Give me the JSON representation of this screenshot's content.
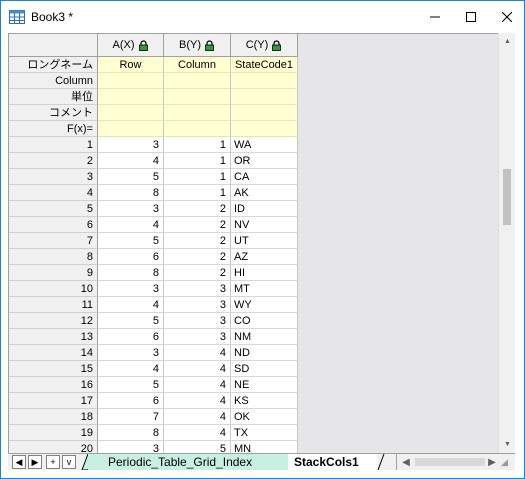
{
  "window": {
    "title": "Book3 *",
    "min_label": "🗕",
    "max_label": "☐",
    "close_label": "✕"
  },
  "columns": [
    {
      "header": "A(X)",
      "longname": "Row",
      "align": "num"
    },
    {
      "header": "B(Y)",
      "longname": "Column",
      "align": "num"
    },
    {
      "header": "C(Y)",
      "longname": "StateCode1",
      "align": "txt"
    }
  ],
  "meta_rows": [
    "ロングネーム",
    "Column",
    "単位",
    "コメント",
    "F(x)="
  ],
  "rows": [
    {
      "n": "1",
      "a": "3",
      "b": "1",
      "c": "WA"
    },
    {
      "n": "2",
      "a": "4",
      "b": "1",
      "c": "OR"
    },
    {
      "n": "3",
      "a": "5",
      "b": "1",
      "c": "CA"
    },
    {
      "n": "4",
      "a": "8",
      "b": "1",
      "c": "AK"
    },
    {
      "n": "5",
      "a": "3",
      "b": "2",
      "c": "ID"
    },
    {
      "n": "6",
      "a": "4",
      "b": "2",
      "c": "NV"
    },
    {
      "n": "7",
      "a": "5",
      "b": "2",
      "c": "UT"
    },
    {
      "n": "8",
      "a": "6",
      "b": "2",
      "c": "AZ"
    },
    {
      "n": "9",
      "a": "8",
      "b": "2",
      "c": "HI"
    },
    {
      "n": "10",
      "a": "3",
      "b": "3",
      "c": "MT"
    },
    {
      "n": "11",
      "a": "4",
      "b": "3",
      "c": "WY"
    },
    {
      "n": "12",
      "a": "5",
      "b": "3",
      "c": "CO"
    },
    {
      "n": "13",
      "a": "6",
      "b": "3",
      "c": "NM"
    },
    {
      "n": "14",
      "a": "3",
      "b": "4",
      "c": "ND"
    },
    {
      "n": "15",
      "a": "4",
      "b": "4",
      "c": "SD"
    },
    {
      "n": "16",
      "a": "5",
      "b": "4",
      "c": "NE"
    },
    {
      "n": "17",
      "a": "6",
      "b": "4",
      "c": "KS"
    },
    {
      "n": "18",
      "a": "7",
      "b": "4",
      "c": "OK"
    },
    {
      "n": "19",
      "a": "8",
      "b": "4",
      "c": "TX"
    },
    {
      "n": "20",
      "a": "3",
      "b": "5",
      "c": "MN"
    }
  ],
  "sheet_tabs": {
    "inactive": "Periodic_Table_Grid_Index",
    "active": "StackCols1"
  },
  "nav_buttons": [
    "◀",
    "▶",
    "+",
    "v"
  ],
  "colors": {
    "meta_bg": "#ffffd2",
    "tab_inactive_bg": "#c8f0e0",
    "lock_green": "#2e9a3a"
  }
}
